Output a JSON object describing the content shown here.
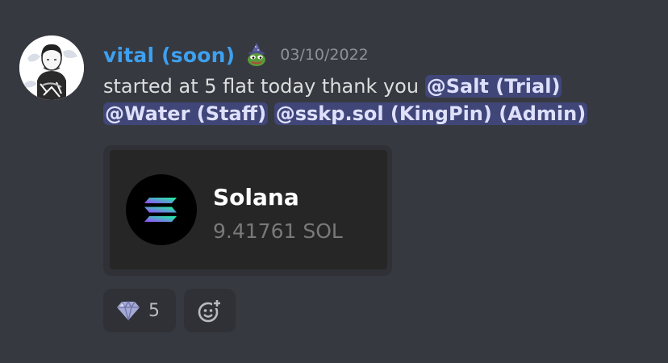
{
  "message": {
    "author": "vital (soon)",
    "role_icon": "pepe-wizard-icon",
    "timestamp": "03/10/2022",
    "text": "started at 5 flat today thank you",
    "mentions": [
      "@Salt (Trial)",
      "@Water (Staff)",
      "@sskp.sol (KingPin) (Admin)"
    ]
  },
  "embed": {
    "logo_icon": "solana-logo-icon",
    "name": "Solana",
    "amount": "9.41761 SOL"
  },
  "reactions": [
    {
      "icon": "gem-icon",
      "count": "5"
    },
    {
      "icon": "add-reaction-icon"
    }
  ],
  "colors": {
    "background": "#36393f",
    "username": "#3ea0f0",
    "mention_bg": "#5865f2",
    "embed_bg": "#2f3136"
  }
}
